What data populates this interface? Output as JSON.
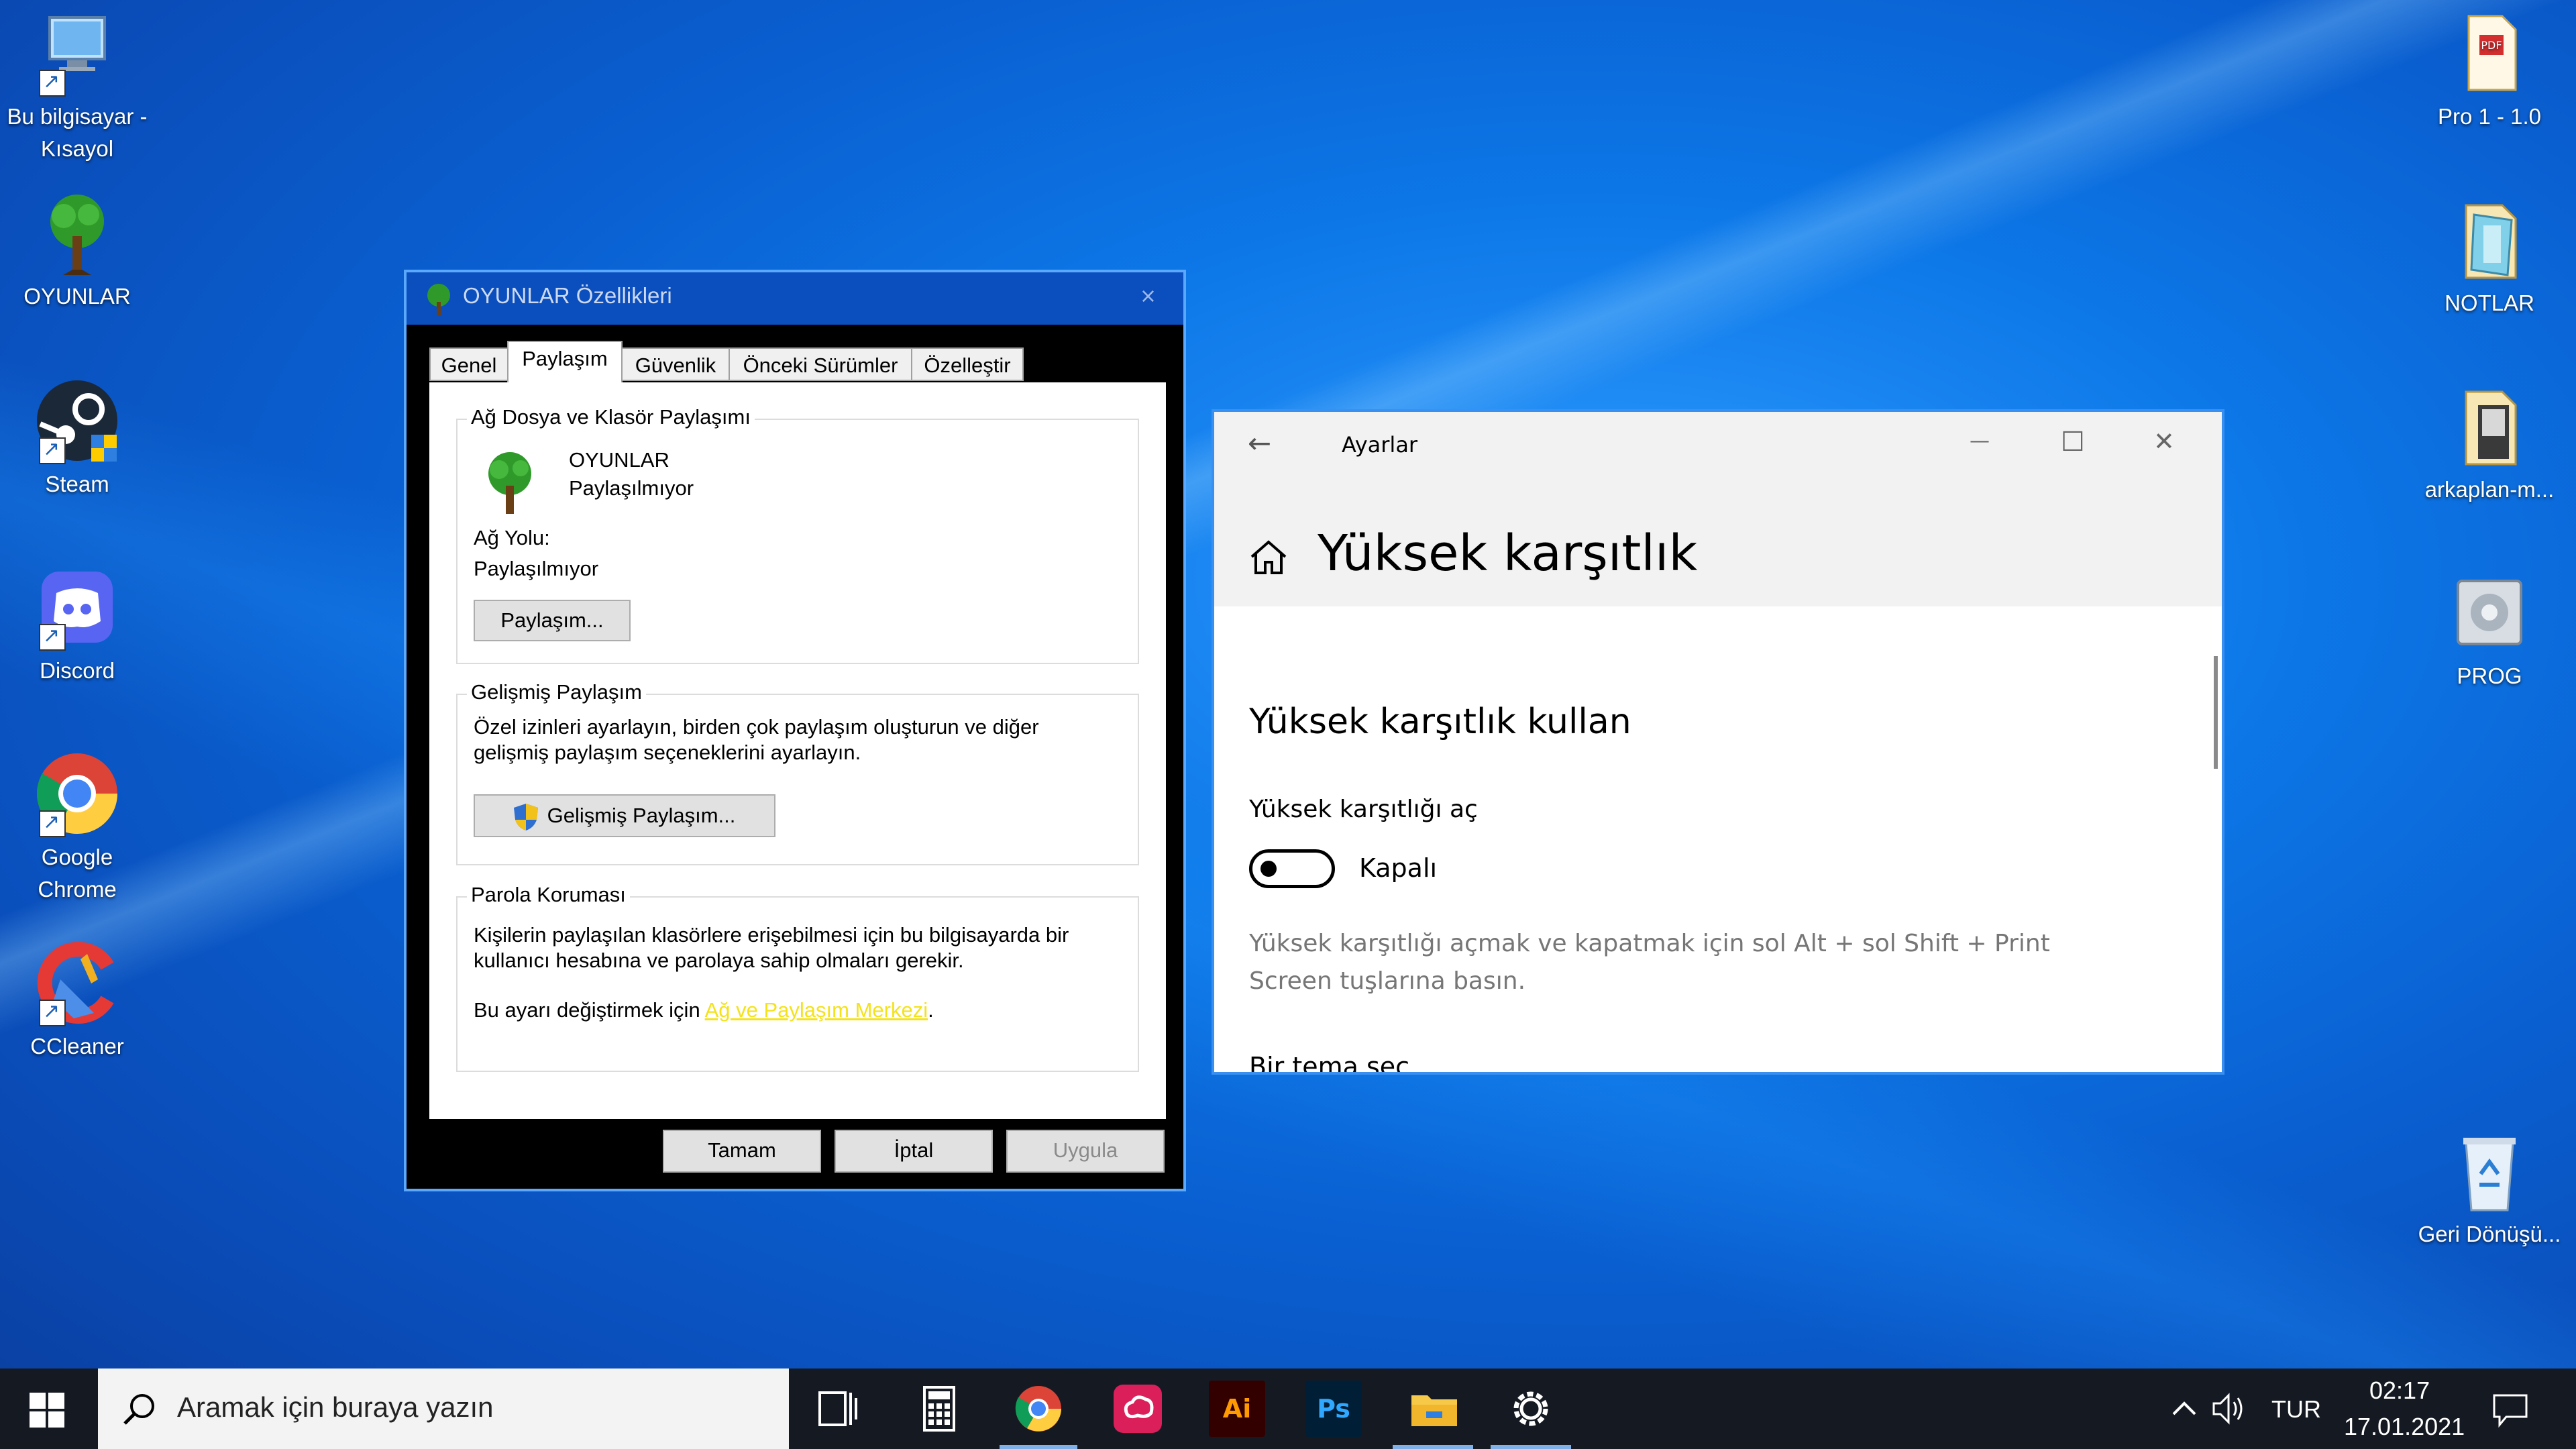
{
  "desktop": {
    "left_icons": [
      {
        "label": "Bu bilgisayar - Kısayol",
        "icon": "computer-icon"
      },
      {
        "label": "OYUNLAR",
        "icon": "tree-folder-icon"
      },
      {
        "label": "Steam",
        "icon": "steam-icon"
      },
      {
        "label": "Discord",
        "icon": "discord-icon"
      },
      {
        "label": "Google Chrome",
        "icon": "chrome-icon"
      },
      {
        "label": "CCleaner",
        "icon": "ccleaner-icon"
      }
    ],
    "right_icons": [
      {
        "label": "Pro 1 - 1.0",
        "icon": "pdf-file-icon"
      },
      {
        "label": "NOTLAR",
        "icon": "notes-file-icon"
      },
      {
        "label": "arkaplan-m...",
        "icon": "image-file-icon"
      },
      {
        "label": "PROG",
        "icon": "setup-program-icon"
      },
      {
        "label": "Geri Dönüşü...",
        "icon": "recycle-bin-icon"
      }
    ]
  },
  "properties": {
    "title": "OYUNLAR Özellikleri",
    "close_glyph": "×",
    "tabs": [
      "Genel",
      "Paylaşım",
      "Güvenlik",
      "Önceki Sürümler",
      "Özelleştir"
    ],
    "active_tab": "Paylaşım",
    "network_sharing": {
      "group_label": "Ağ Dosya ve Klasör Paylaşımı",
      "folder_name": "OYUNLAR",
      "folder_status": "Paylaşılmıyor",
      "path_label": "Ağ Yolu:",
      "path_value": "Paylaşılmıyor",
      "share_button": "Paylaşım..."
    },
    "advanced_sharing": {
      "group_label": "Gelişmiş Paylaşım",
      "description_line1": "Özel izinleri ayarlayın, birden çok paylaşım oluşturun ve diğer",
      "description_line2": "gelişmiş paylaşım seçeneklerini ayarlayın.",
      "button": "Gelişmiş Paylaşım..."
    },
    "password_protection": {
      "group_label": "Parola Koruması",
      "description_line1": "Kişilerin paylaşılan klasörlere erişebilmesi için bu bilgisayarda bir",
      "description_line2": "kullanıcı hesabına ve parolaya sahip olmaları gerekir.",
      "change_prefix": "Bu ayarı değiştirmek için",
      "change_link": "Ağ ve Paylaşım Merkezi",
      "change_suffix": "."
    },
    "buttons": {
      "ok": "Tamam",
      "cancel": "İptal",
      "apply": "Uygula"
    }
  },
  "settings": {
    "app_title": "Ayarlar",
    "back_glyph": "←",
    "minimize_glyph": "—",
    "maximize_glyph": "☐",
    "close_glyph": "✕",
    "page_title": "Yüksek karşıtlık",
    "section_title": "Yüksek karşıtlık kullan",
    "toggle_label": "Yüksek karşıtlığı aç",
    "toggle_state": "Kapalı",
    "hint_line1": "Yüksek karşıtlığı açmak ve kapatmak için sol Alt + sol Shift + Print",
    "hint_line2": "Screen tuşlarına basın.",
    "next_heading": "Bir tema seç"
  },
  "taskbar": {
    "search_placeholder": "Aramak için buraya yazın",
    "apps": [
      "task-view-icon",
      "calculator-icon",
      "chrome-icon",
      "creative-cloud-icon",
      "illustrator-icon",
      "photoshop-icon",
      "file-explorer-icon",
      "settings-gear-icon"
    ],
    "illustrator_label": "Ai",
    "photoshop_label": "Ps",
    "language": "TUR",
    "time": "02:17",
    "date": "17.01.2021"
  },
  "colors": {
    "link": "#f4e21a",
    "taskbar": "#151a22",
    "desktop_blue": "#0d78e8"
  }
}
